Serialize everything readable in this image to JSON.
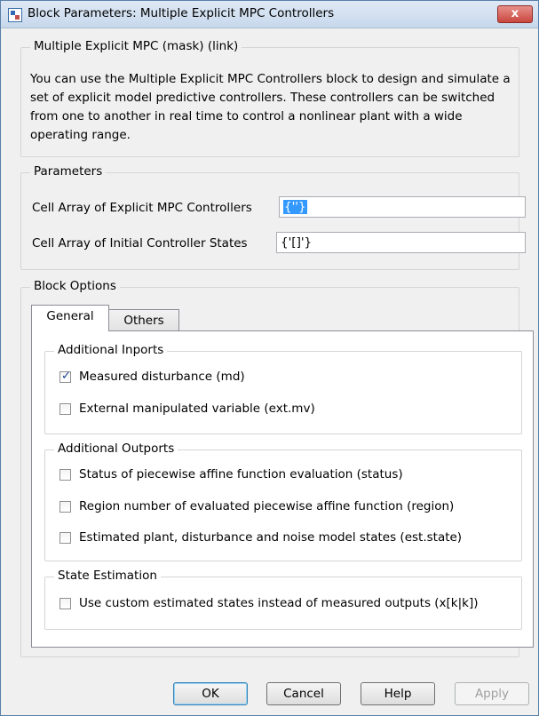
{
  "window": {
    "title": "Block Parameters: Multiple Explicit MPC Controllers",
    "close_glyph": "x"
  },
  "mask_group": {
    "legend": "Multiple Explicit MPC (mask) (link)",
    "description": "You can use the Multiple Explicit MPC Controllers block to design and simulate a set of explicit model predictive controllers. These controllers can be switched from one to another in real time to control a nonlinear plant with a wide operating range."
  },
  "parameters": {
    "legend": "Parameters",
    "controllers_label": "Cell Array of Explicit MPC Controllers",
    "controllers_value": "{''}",
    "states_label": "Cell Array of Initial Controller States",
    "states_value": "{'[]'}"
  },
  "block_options": {
    "legend": "Block Options",
    "tabs": [
      {
        "label": "General",
        "active": true
      },
      {
        "label": "Others",
        "active": false
      }
    ]
  },
  "inports": {
    "legend": "Additional Inports",
    "items": [
      {
        "label": "Measured disturbance (md)",
        "checked": true
      },
      {
        "label": "External manipulated variable (ext.mv)",
        "checked": false
      }
    ]
  },
  "outports": {
    "legend": "Additional Outports",
    "items": [
      {
        "label": "Status of piecewise affine function evaluation (status)",
        "checked": false
      },
      {
        "label": "Region number of evaluated piecewise affine function (region)",
        "checked": false
      },
      {
        "label": "Estimated plant, disturbance and noise model states (est.state)",
        "checked": false
      }
    ]
  },
  "state_estimation": {
    "legend": "State Estimation",
    "items": [
      {
        "label": "Use custom estimated states instead of measured outputs (x[k|k])",
        "checked": false
      }
    ]
  },
  "buttons": {
    "ok": "OK",
    "cancel": "Cancel",
    "help": "Help",
    "apply": "Apply"
  }
}
